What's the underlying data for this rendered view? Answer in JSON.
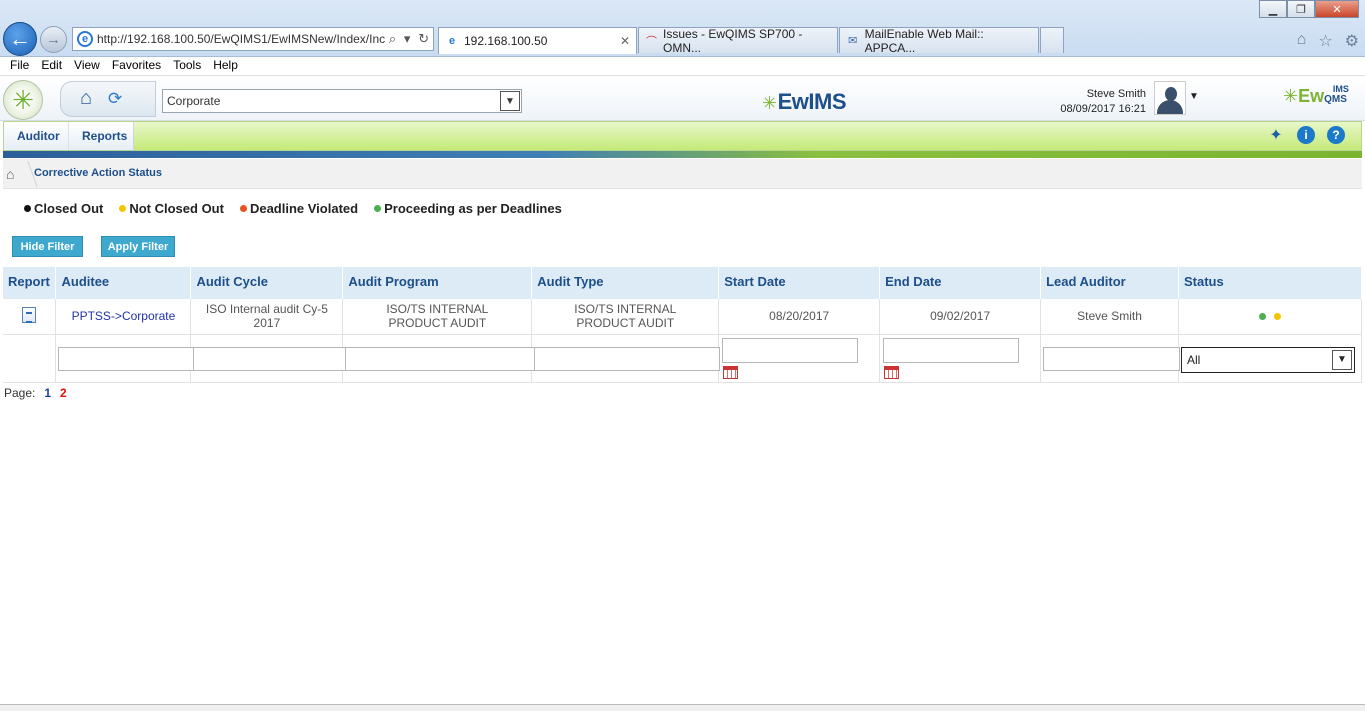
{
  "browser": {
    "address_url": "http://192.168.100.50/EwQIMS1/EwIMSNew/Index/Inc",
    "tabs": [
      {
        "label": "192.168.100.50",
        "active": true
      },
      {
        "label": "Issues - EwQIMS SP700 - OMN...",
        "active": false
      },
      {
        "label": "MailEnable Web Mail:: APPCA...",
        "active": false
      }
    ],
    "menu": [
      "File",
      "Edit",
      "View",
      "Favorites",
      "Tools",
      "Help"
    ]
  },
  "header": {
    "organization": "Corporate",
    "center_logo": "EwIMS",
    "user_name": "Steve Smith",
    "user_datetime": "08/09/2017 16:21",
    "right_logo_main": "Ew",
    "right_logo_q": "QMS",
    "right_logo_ims": "IMS"
  },
  "nav": {
    "items": [
      "Auditor",
      "Reports"
    ]
  },
  "breadcrumb": {
    "title": "Corrective Action Status"
  },
  "legend": [
    {
      "label": "Closed Out",
      "color": "#111111"
    },
    {
      "label": "Not Closed Out",
      "color": "#f2c500"
    },
    {
      "label": "Deadline Violated",
      "color": "#e8541e"
    },
    {
      "label": "Proceeding as per Deadlines",
      "color": "#4caf50"
    }
  ],
  "filters": {
    "hide_label": "Hide Filter",
    "apply_label": "Apply Filter",
    "status_selected": "All"
  },
  "table": {
    "columns": [
      "Report",
      "Auditee",
      "Audit Cycle",
      "Audit Program",
      "Audit Type",
      "Start Date",
      "End Date",
      "Lead Auditor",
      "Status"
    ],
    "rows": [
      {
        "auditee": "PPTSS->Corporate",
        "audit_cycle": "ISO Internal audit Cy-5 2017",
        "audit_program": "ISO/TS INTERNAL PRODUCT AUDIT",
        "audit_type": "ISO/TS INTERNAL PRODUCT AUDIT",
        "start_date": "08/20/2017",
        "end_date": "09/02/2017",
        "lead_auditor": "Steve Smith",
        "status_colors": [
          "#4caf50",
          "#f2c500"
        ]
      }
    ]
  },
  "pager": {
    "label": "Page:",
    "pages": [
      "1",
      "2"
    ]
  }
}
